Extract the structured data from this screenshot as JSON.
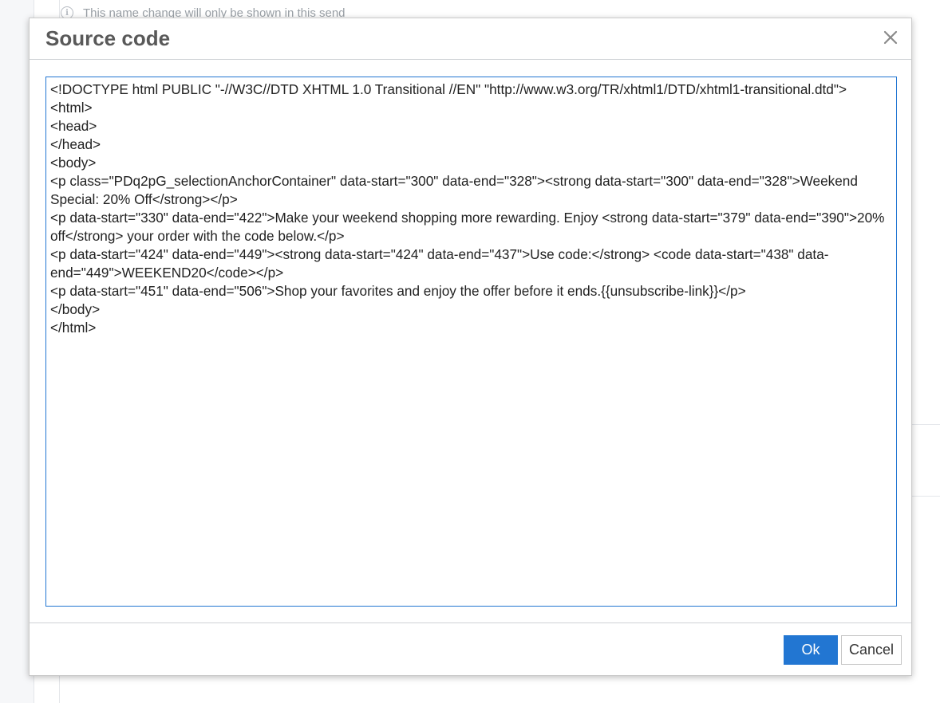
{
  "background": {
    "notice_text": "This name change will only be shown in this send",
    "notice_icon": "info-icon"
  },
  "dialog": {
    "title": "Source code",
    "close_icon": "close-icon",
    "source_code": "<!DOCTYPE html PUBLIC \"-//W3C//DTD XHTML 1.0 Transitional //EN\" \"http://www.w3.org/TR/xhtml1/DTD/xhtml1-transitional.dtd\">\n<html>\n<head>\n</head>\n<body>\n<p class=\"PDq2pG_selectionAnchorContainer\" data-start=\"300\" data-end=\"328\"><strong data-start=\"300\" data-end=\"328\">Weekend Special: 20% Off</strong></p>\n<p data-start=\"330\" data-end=\"422\">Make your weekend shopping more rewarding. Enjoy <strong data-start=\"379\" data-end=\"390\">20% off</strong> your order with the code below.</p>\n<p data-start=\"424\" data-end=\"449\"><strong data-start=\"424\" data-end=\"437\">Use code:</strong> <code data-start=\"438\" data-end=\"449\">WEEKEND20</code></p>\n<p data-start=\"451\" data-end=\"506\">Shop your favorites and enjoy the offer before it ends.{{unsubscribe-link}}</p>\n</body>\n</html>",
    "ok_label": "Ok",
    "cancel_label": "Cancel"
  },
  "colors": {
    "accent": "#2276d2",
    "title_text": "#595959",
    "border": "#cfd2d6"
  }
}
